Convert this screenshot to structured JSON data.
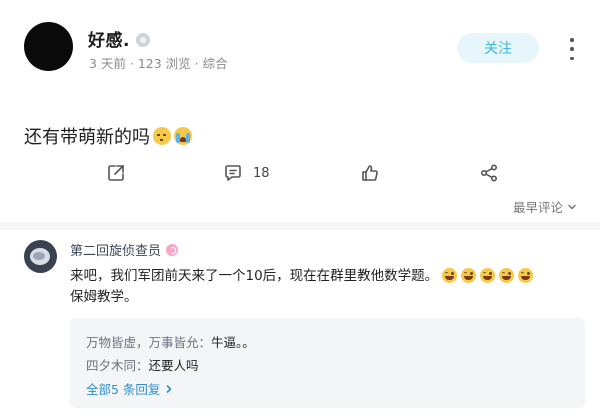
{
  "post": {
    "author": "好感.",
    "meta": "3 天前 · 123 浏览 · 综合",
    "follow_label": "关注",
    "body_text": "还有带萌新的吗",
    "body_emojis": [
      "pensive-emoji",
      "crying-emoji"
    ]
  },
  "actions": {
    "comment_count": "18"
  },
  "comments": {
    "sort_label": "最早评论",
    "first": {
      "author": "第二回旋侦查员",
      "text": "来吧，我们军团前天来了一个10后，现在在群里教他数学题。",
      "text_line2": "保姆教学。",
      "emoji_count": 5,
      "replies": [
        {
          "name": "万物皆虚，万事皆允：",
          "text": "牛逼。。"
        },
        {
          "name": "四夕木同：",
          "text": "还要人吗"
        }
      ],
      "more_replies_label": "全部5 条回复"
    }
  },
  "colors": {
    "accent": "#3fb7d6",
    "link": "#2f8fce"
  }
}
